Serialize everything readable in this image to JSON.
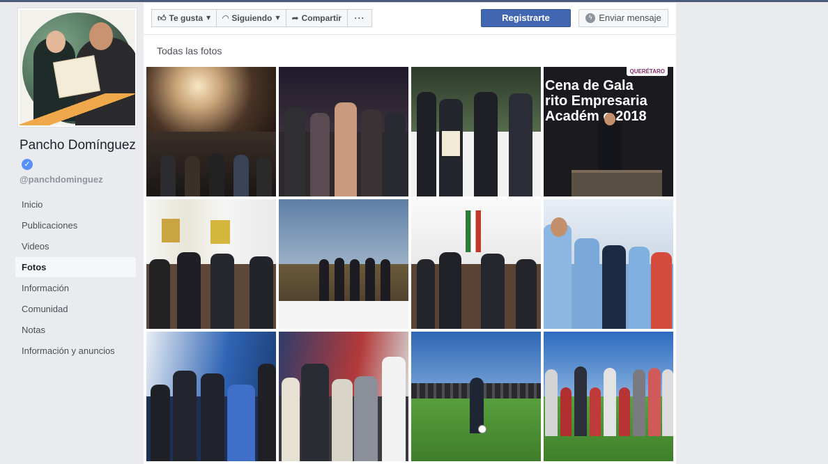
{
  "profile": {
    "name": "Pancho Domínguez",
    "verified_glyph": "✓",
    "username": "@panchdominguez"
  },
  "nav": {
    "items": [
      {
        "label": "Inicio"
      },
      {
        "label": "Publicaciones"
      },
      {
        "label": "Videos"
      },
      {
        "label": "Fotos",
        "active": true
      },
      {
        "label": "Información"
      },
      {
        "label": "Comunidad"
      },
      {
        "label": "Notas"
      },
      {
        "label": "Información y anuncios"
      }
    ]
  },
  "actions": {
    "like_label": "Te gusta",
    "following_label": "Siguiendo",
    "share_label": "Compartir",
    "more_label": "···",
    "register_label": "Registrarte",
    "message_label": "Enviar mensaje"
  },
  "photos": {
    "section_title": "Todas las fotos",
    "gala_line1": "Cena de Gala",
    "gala_line2": "rito Empresaria",
    "gala_line3": "Académ   o 2018",
    "gala_tag": "QUERÉTARO"
  },
  "colors": {
    "page_bg": "#e9ebee",
    "brand_blue": "#4267b2",
    "verified_blue": "#5890ff",
    "active_nav_bg": "#f6f7f9"
  },
  "icons": {
    "like": "thumbs-up-icon",
    "following": "rss-icon",
    "share": "share-arrow-icon",
    "message": "messenger-icon"
  }
}
